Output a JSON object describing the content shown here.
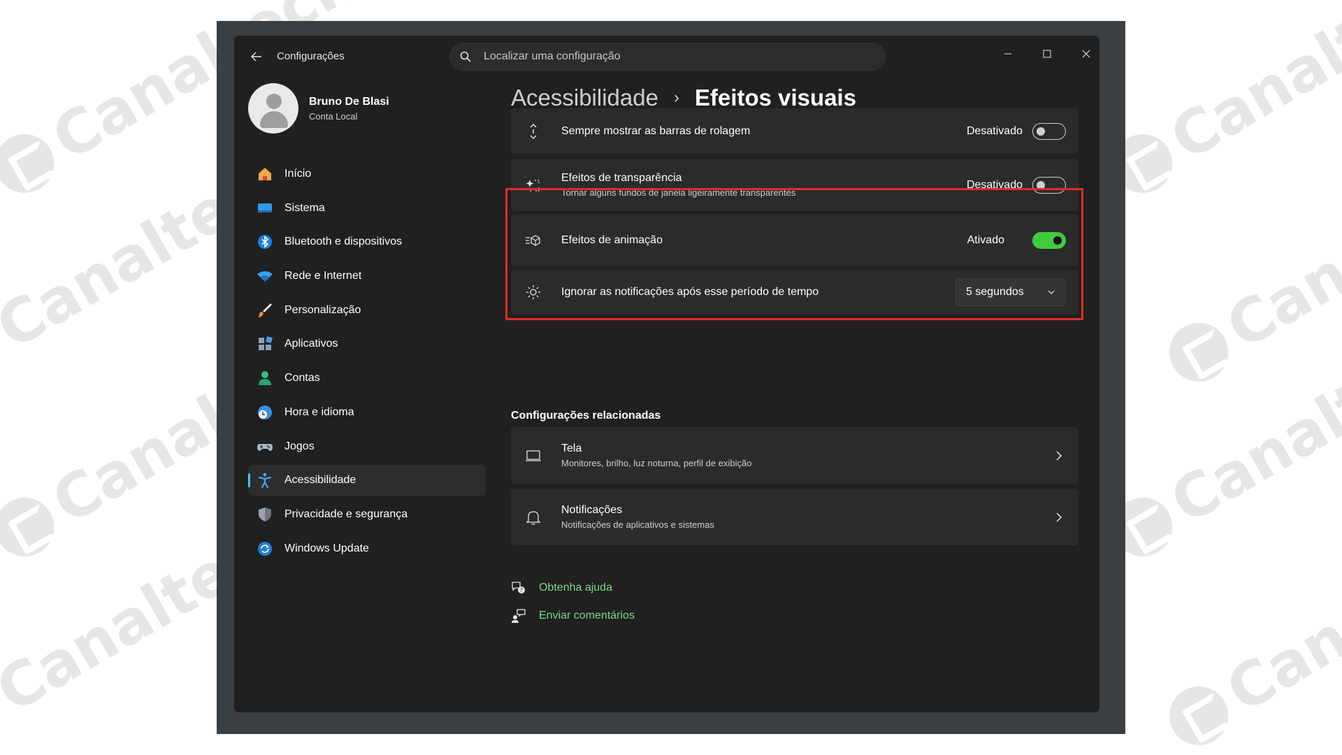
{
  "watermark": {
    "text": "Canaltech"
  },
  "window": {
    "app_title": "Configurações",
    "search_placeholder": "Localizar uma configuração",
    "controls": [
      "minimize-icon",
      "maximize-icon",
      "close-icon"
    ]
  },
  "profile": {
    "name": "Bruno De Blasi",
    "account": "Conta Local"
  },
  "sidebar": {
    "items": [
      {
        "label": "Início",
        "icon": "home-icon",
        "selected": false
      },
      {
        "label": "Sistema",
        "icon": "display-icon",
        "selected": false
      },
      {
        "label": "Bluetooth e dispositivos",
        "icon": "bluetooth-icon",
        "selected": false
      },
      {
        "label": "Rede e Internet",
        "icon": "wifi-icon",
        "selected": false
      },
      {
        "label": "Personalização",
        "icon": "brush-icon",
        "selected": false
      },
      {
        "label": "Aplicativos",
        "icon": "apps-icon",
        "selected": false
      },
      {
        "label": "Contas",
        "icon": "person-icon",
        "selected": false
      },
      {
        "label": "Hora e idioma",
        "icon": "globe-clock-icon",
        "selected": false
      },
      {
        "label": "Jogos",
        "icon": "gamepad-icon",
        "selected": false
      },
      {
        "label": "Acessibilidade",
        "icon": "accessibility-icon",
        "selected": true
      },
      {
        "label": "Privacidade e segurança",
        "icon": "shield-icon",
        "selected": false
      },
      {
        "label": "Windows Update",
        "icon": "refresh-icon",
        "selected": false
      }
    ]
  },
  "main": {
    "breadcrumb": {
      "parent": "Acessibilidade",
      "separator": "›",
      "current": "Efeitos visuais"
    },
    "settings": [
      {
        "title": "Sempre mostrar as barras de rolagem",
        "desc": "",
        "state": "Desativado",
        "on": false
      },
      {
        "title": "Efeitos de transparência",
        "desc": "Tornar alguns fundos de janela ligeiramente transparentes",
        "state": "Desativado",
        "on": false
      },
      {
        "title": "Efeitos de animação",
        "desc": "",
        "state": "Ativado",
        "on": true
      },
      {
        "title": "Ignorar as notificações após esse período de tempo",
        "desc": "",
        "dropdown": "5 segundos"
      }
    ],
    "related_title": "Configurações relacionadas",
    "related": [
      {
        "title": "Tela",
        "desc": "Monitores, brilho, luz noturna, perfil de exibição"
      },
      {
        "title": "Notificações",
        "desc": "Notificações de aplicativos e sistemas"
      }
    ],
    "links": [
      {
        "label": "Obtenha ajuda"
      },
      {
        "label": "Enviar comentários"
      }
    ]
  },
  "colors": {
    "accent_toggle": "#3fcb3f",
    "highlight_border": "#e32a2a",
    "link": "#7fd68a",
    "window_bg": "#202020",
    "card_bg": "#2b2b2b"
  }
}
